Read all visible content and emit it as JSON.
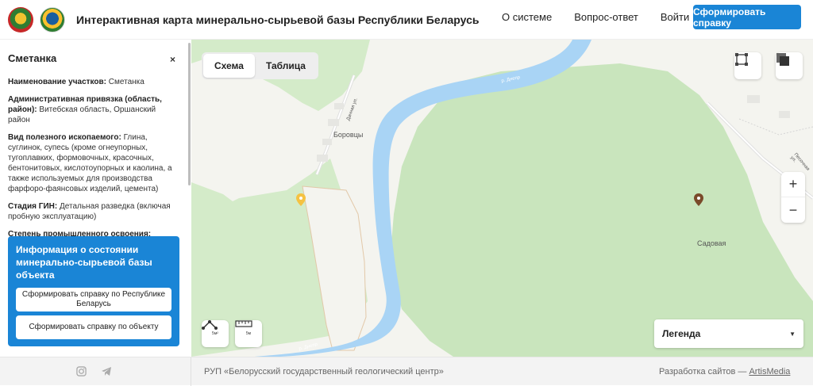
{
  "header": {
    "title": "Интерактивная карта минерально-сырьевой базы Республики Беларусь",
    "nav": [
      "О системе",
      "Вопрос-ответ",
      "Войти"
    ],
    "report_button": "Сформировать справку"
  },
  "panel": {
    "title": "Сметанка",
    "close": "×",
    "rows": [
      {
        "label": "Наименование участков:",
        "value": " Сметанка"
      },
      {
        "label": "Административная привязка (область, район):",
        "value": " Витебская область, Оршанский район"
      },
      {
        "label": "Вид полезного ископаемого:",
        "value": " Глина, суглинок, супесь (кроме огнеупорных, тугоплавких, формовочных, красочных, бентонитовых, кислотоупорных и каолина, а также используемых для производства фарфоро-фаянсовых изделий, цемента)"
      },
      {
        "label": "Стадия ГИН:",
        "value": " Детальная разведка (включая пробную эксплуатацию)"
      },
      {
        "label": "Степень промышленного освоения:",
        "value": ""
      }
    ],
    "info_box": {
      "title": "Информация о состоянии минерально-сырьевой базы объекта",
      "btn_country": "Сформировать справку по Республике Беларусь",
      "btn_object": "Сформировать справку по объекту"
    }
  },
  "map": {
    "tabs": [
      "Схема",
      "Таблица"
    ],
    "active_tab": "Схема",
    "labels": {
      "village1": "Боровцы",
      "village2": "Садовая",
      "street": "Дачная ул.",
      "river": "р. Днепр",
      "road": "Песочная ул."
    },
    "area_tool_label": "5м²",
    "ruler_tool_label": "5м",
    "zoom_in": "+",
    "zoom_out": "−",
    "legend": "Легенда",
    "colors": {
      "forest": "#cde8c3",
      "water": "#a9d4f5",
      "marker_yellow": "#f5c242",
      "marker_brown": "#7a4a2a"
    }
  },
  "footer": {
    "org": "РУП «Белорусский государственный геологический центр»",
    "dev_prefix": "Разработка сайтов — ",
    "dev_link": "ArtisMedia"
  }
}
